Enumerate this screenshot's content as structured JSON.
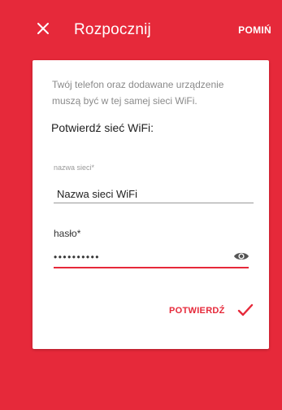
{
  "header": {
    "title": "Rozpocznij",
    "skip_label": "POMIŃ"
  },
  "card": {
    "description": "Twój telefon oraz dodawane urządzenie muszą być w tej samej sieci WiFi.",
    "subheading": "Potwierdź sieć WiFi:",
    "ssid_label": "nazwa sieci*",
    "ssid_value": "Nazwa sieci WiFi",
    "password_label": "hasło*",
    "password_value": "••••••••••",
    "confirm_label": "POTWIERDŹ"
  },
  "colors": {
    "accent": "#e6293a",
    "background": "#e6293a",
    "card": "#ffffff"
  },
  "icons": {
    "close": "close-icon",
    "show_password": "eye-icon",
    "confirm": "check-icon"
  }
}
